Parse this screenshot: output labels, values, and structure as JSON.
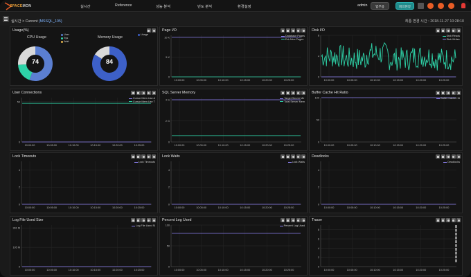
{
  "app": {
    "brand_main": "SPACE",
    "brand_sub": "MON"
  },
  "nav": {
    "realtime": "실시간",
    "reference": "Reference",
    "perf": "성능 분석",
    "trend": "빈도 분석",
    "settings": "환경설정"
  },
  "header": {
    "user": "admin",
    "biz_btn": "업무용",
    "meeting_btn": "회의현장",
    "colors": {
      "teal": "#1f8c8c",
      "orange": "#e85d26",
      "red": "#e53935"
    }
  },
  "breadcrumb": {
    "prefix": "실시간 > Current",
    "instance": "(MSSQL_105)"
  },
  "updated": "최종 변경 시간 : 2018-11-27 10:28:10",
  "panels": [
    {
      "id": "usage",
      "title": "Usage(%)"
    },
    {
      "id": "page-io",
      "title": "Page I/O"
    },
    {
      "id": "disk-io",
      "title": "Disk I/O"
    },
    {
      "id": "user-connections",
      "title": "User Connections"
    },
    {
      "id": "sql-memory",
      "title": "SQL Server Memory"
    },
    {
      "id": "buffer-cache",
      "title": "Buffer Cache Hit Ratio"
    },
    {
      "id": "lock-timeouts",
      "title": "Lock Timeouts"
    },
    {
      "id": "lock-waits",
      "title": "Lock Waits"
    },
    {
      "id": "deadlocks",
      "title": "Deadlocks"
    },
    {
      "id": "log-file",
      "title": "Log File Used Size"
    },
    {
      "id": "log-used",
      "title": "Percent Log Used"
    },
    {
      "id": "tracer",
      "title": "Tracer"
    }
  ],
  "usage": {
    "cpu_title": "CPU Usage",
    "cpu_value": "74",
    "cpu_legend": [
      "User",
      "Sys",
      "Wait"
    ],
    "cpu_colors": [
      "#5b7fd1",
      "#2ed3a8",
      "#e0b24a"
    ],
    "mem_title": "Memory Usage",
    "mem_value": "84",
    "mem_legend": [
      "Usage"
    ],
    "mem_color": "#3d60c8"
  },
  "chart_data": [
    {
      "panel": "page-io",
      "type": "line",
      "x": [
        "10:00:00",
        "10:05:00",
        "10:10:00",
        "10:15:00",
        "10:20:00",
        "10:25:00"
      ],
      "yticks": [
        "0",
        "5 K",
        "10 K"
      ],
      "ylim": [
        0,
        10500
      ],
      "series": [
        {
          "name": "Database Pages",
          "color": "#8b7ff0",
          "values": [
            10000,
            10000,
            10000,
            10000,
            10000,
            10000
          ]
        },
        {
          "name": "Ext Alloc Pages",
          "color": "#2ed3a8",
          "values": [
            0,
            0,
            0,
            0,
            0,
            0
          ]
        }
      ]
    },
    {
      "panel": "disk-io",
      "type": "line",
      "x": [
        "10:00:00",
        "10:05:00",
        "10:10:00",
        "10:15:00",
        "10:20:00",
        "10:25:00"
      ],
      "yticks": [
        "0",
        "4",
        "8"
      ],
      "ylim": [
        0,
        8
      ],
      "series": [
        {
          "name": "Disk Reads",
          "color": "#2ed3a8",
          "noisy": true,
          "values": [
            3.5,
            3,
            4,
            3,
            3.5,
            3
          ]
        },
        {
          "name": "Disk Writes",
          "color": "#8b7ff0",
          "values": [
            0,
            0,
            0,
            0,
            0,
            0
          ]
        }
      ]
    },
    {
      "panel": "user-connections",
      "type": "line",
      "x": [
        "10:00:00",
        "10:05:00",
        "10:10:00",
        "10:15:00",
        "10:20:00",
        "10:25:00"
      ],
      "yticks": [
        "0",
        "50"
      ],
      "ylim": [
        0,
        55
      ],
      "series": [
        {
          "name": "Cursor Mem Use A",
          "color": "#8b7ff0",
          "values": [
            0,
            0,
            0,
            0,
            0,
            0
          ]
        },
        {
          "name": "Cursor Mem Use T",
          "color": "#2ed3a8",
          "values": [
            48,
            48,
            48,
            48,
            48,
            48
          ]
        }
      ]
    },
    {
      "panel": "sql-memory",
      "type": "line",
      "x": [
        "10:00:00",
        "10:05:00",
        "10:10:00",
        "10:15:00",
        "10:20:00",
        "10:25:00"
      ],
      "yticks": [
        "0",
        "2 G",
        "4 G"
      ],
      "ylim": [
        0,
        4.2
      ],
      "series": [
        {
          "name": "Target Server Me",
          "color": "#8b7ff0",
          "values": [
            4,
            4,
            4,
            4,
            4,
            4
          ]
        },
        {
          "name": "Total Server Mem",
          "color": "#2ed3a8",
          "values": [
            0.6,
            0.6,
            0.6,
            0.6,
            0.6,
            0.6
          ]
        }
      ]
    },
    {
      "panel": "buffer-cache",
      "type": "line",
      "x": [
        "10:00:00",
        "10:05:00",
        "10:10:00",
        "10:15:00",
        "10:20:00",
        "10:25:00"
      ],
      "yticks": [
        "0",
        "50",
        "100"
      ],
      "ylim": [
        0,
        100
      ],
      "series": [
        {
          "name": "Buffer Cache Hit",
          "color": "#8b7ff0",
          "values": [
            100,
            100,
            100,
            100,
            100,
            100
          ]
        }
      ]
    },
    {
      "panel": "lock-timeouts",
      "type": "line",
      "x": [
        "10:00:00",
        "10:05:00",
        "10:10:00",
        "10:15:00",
        "10:20:00",
        "10:25:00"
      ],
      "yticks": [
        "0",
        "2",
        "4"
      ],
      "ylim": [
        0,
        5
      ],
      "series": [
        {
          "name": "Lock Timeouts",
          "color": "#8b7ff0",
          "values": [
            0,
            0,
            0,
            0,
            0,
            0
          ]
        }
      ]
    },
    {
      "panel": "lock-waits",
      "type": "line",
      "x": [
        "10:00:00",
        "10:05:00",
        "10:10:00",
        "10:15:00",
        "10:20:00",
        "10:25:00"
      ],
      "yticks": [
        "0",
        "2",
        "4"
      ],
      "ylim": [
        0,
        5
      ],
      "series": [
        {
          "name": "Lock Waits",
          "color": "#8b7ff0",
          "values": [
            0,
            0,
            0,
            0,
            0,
            0
          ]
        }
      ]
    },
    {
      "panel": "deadlocks",
      "type": "line",
      "x": [
        "10:00:00",
        "10:05:00",
        "10:10:00",
        "10:15:00",
        "10:20:00",
        "10:25:00"
      ],
      "yticks": [
        "0",
        "2",
        "4"
      ],
      "ylim": [
        0,
        5
      ],
      "series": [
        {
          "name": "Deadlocks",
          "color": "#8b7ff0",
          "values": [
            0,
            0,
            0,
            0,
            0,
            0
          ]
        }
      ]
    },
    {
      "panel": "log-file",
      "type": "line",
      "x": [
        "10:00:00",
        "10:05:00",
        "10:10:00",
        "10:15:00",
        "10:20:00",
        "10:25:00"
      ],
      "yticks": [
        "0",
        "195 M",
        "391 M"
      ],
      "ylim": [
        0,
        420
      ],
      "series": [
        {
          "name": "Log File Used Si",
          "color": "#8b7ff0",
          "values": [
            0,
            0,
            0,
            0,
            0,
            0
          ]
        }
      ]
    },
    {
      "panel": "log-used",
      "type": "line",
      "x": [
        "10:00:00",
        "10:05:00",
        "10:10:00",
        "10:15:00",
        "10:20:00",
        "10:25:00"
      ],
      "yticks": [
        "0",
        "50",
        "100"
      ],
      "ylim": [
        0,
        100
      ],
      "series": [
        {
          "name": "Percent Log Used",
          "color": "#8b7ff0",
          "values": [
            80,
            80,
            80,
            80,
            80,
            80
          ]
        }
      ]
    },
    {
      "panel": "tracer",
      "type": "scatter",
      "x": [
        "10:00:00",
        "10:05:00",
        "10:10:00",
        "10:15:00",
        "10:20:00",
        "10:25:00"
      ],
      "yticks": [
        "0",
        "2",
        "4",
        "6",
        "8"
      ],
      "ylim": [
        0,
        9
      ],
      "series": []
    }
  ]
}
